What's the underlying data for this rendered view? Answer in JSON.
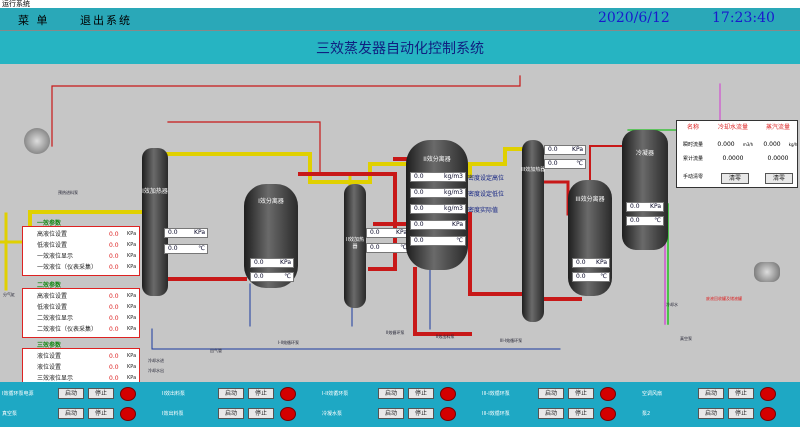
{
  "window": {
    "title": "运行系统"
  },
  "header": {
    "menu_label": "菜 单",
    "exit_label": "退出系统",
    "date": "2020/6/12",
    "time": "17:23:40"
  },
  "main": {
    "title": "三效蒸发器自动化控制系统"
  },
  "panels": {
    "one": {
      "title": "一效参数",
      "rows": [
        {
          "label": "高液位设置",
          "value": "0.0",
          "unit": "KPa"
        },
        {
          "label": "低液位设置",
          "value": "0.0",
          "unit": "KPa"
        },
        {
          "label": "一效液位显示",
          "value": "0.0",
          "unit": "KPa"
        },
        {
          "label": "一效液位（仪表采集）",
          "value": "0.0",
          "unit": "KPa"
        }
      ]
    },
    "two": {
      "title": "二效参数",
      "rows": [
        {
          "label": "高液位设置",
          "value": "0.0",
          "unit": "KPa"
        },
        {
          "label": "低液位设置",
          "value": "0.0",
          "unit": "KPa"
        },
        {
          "label": "二效液位显示",
          "value": "0.0",
          "unit": "KPa"
        },
        {
          "label": "二效液位（仪表采集）",
          "value": "0.0",
          "unit": "KPa"
        }
      ]
    },
    "three": {
      "title": "三效参数",
      "rows": [
        {
          "label": "液位设置",
          "value": "0.0",
          "unit": "KPa"
        },
        {
          "label": "液位设置",
          "value": "0.0",
          "unit": "KPa"
        },
        {
          "label": "三效液位显示",
          "value": "0.0",
          "unit": "KPa"
        },
        {
          "label": "三效液位（仪表采集）",
          "value": "0.0",
          "unit": "KPa"
        }
      ]
    }
  },
  "vessels": {
    "heater1": {
      "label": "I效加热器",
      "p": "0.0",
      "p_unit": "KPa",
      "t": "0.0",
      "t_unit": "℃"
    },
    "sep1": {
      "label": "I效分离器",
      "p": "0.0",
      "p_unit": "KPa",
      "t": "0.0",
      "t_unit": "℃"
    },
    "heater2": {
      "label": "II效加热器",
      "p": "0.0",
      "p_unit": "KPa",
      "t": "0.0",
      "t_unit": "℃"
    },
    "sep2": {
      "label": "II效分离器",
      "rows": [
        {
          "v": "0.0",
          "u": "kg/m3",
          "label": "密度设定高位"
        },
        {
          "v": "0.0",
          "u": "kg/m3",
          "label": "密度设定低位"
        },
        {
          "v": "0.0",
          "u": "kg/m3",
          "label": "密度实际值"
        },
        {
          "v": "0.0",
          "u": "KPa",
          "label": ""
        },
        {
          "v": "0.0",
          "u": "℃",
          "label": ""
        }
      ]
    },
    "heater3": {
      "label": "III效加热器",
      "p": "0.0",
      "p_unit": "KPa",
      "t": "0.0",
      "t_unit": "℃"
    },
    "sep3": {
      "label": "III效分离器",
      "p": "0.0",
      "p_unit": "KPa",
      "t": "0.0",
      "t_unit": "℃"
    },
    "condenser": {
      "label": "冷凝器",
      "p": "0.0",
      "p_unit": "KPa",
      "t": "0.0",
      "t_unit": "℃"
    }
  },
  "flow_table": {
    "name_hdr": "名称",
    "cool_hdr": "冷却水流量",
    "steam_hdr": "蒸汽流量",
    "rows": [
      {
        "label": "瞬时流量",
        "cool": "0.000",
        "cool_unit": "m3/h",
        "steam": "0.000",
        "steam_unit": "kg/h"
      },
      {
        "label": "累计流量",
        "cool": "0.0000",
        "steam": "0.0000"
      }
    ],
    "reset_label": "手动清零",
    "clear1": "清零",
    "clear2": "清零"
  },
  "labels": {
    "raw_tank": "原液储罐",
    "preheat_pump": "预热进料泵",
    "steam_in": "分气缸",
    "pump1": "I-II效循环泵",
    "pump2": "I-II效循环泵",
    "pump3": "II效循环泵",
    "pump4": "II效出料泵",
    "pump5": "III-I效循环泵",
    "cond_pump": "冷凝水泵",
    "vac_pump": "真空泵",
    "mother": "母液储罐",
    "cooling_in": "冷却水进",
    "cooling_out": "冷却水出",
    "cooling_water": "冷却水",
    "condensate": "冷凝水出口",
    "steam_line": "分汽缸",
    "outlet": "出料",
    "backwater": "回气管",
    "right_note": "废液回收罐及储液罐",
    "vacuum": "真空泵"
  },
  "bottom": {
    "groups": [
      {
        "label": "I效循环泵电源",
        "start": "启动",
        "stop": "停止"
      },
      {
        "label": "II效出料泵",
        "start": "启动",
        "stop": "停止"
      },
      {
        "label": "I-II效循环泵",
        "start": "启动",
        "stop": "停止"
      },
      {
        "label": "III-I效循环泵",
        "start": "启动",
        "stop": "停止"
      },
      {
        "label": "空调风扇",
        "start": "启动",
        "stop": "停止"
      },
      {
        "label": "真空泵",
        "start": "启动",
        "stop": "停止"
      },
      {
        "label": "I效出料泵",
        "start": "启动",
        "stop": "停止"
      },
      {
        "label": "冷凝水泵",
        "start": "启动",
        "stop": "停止"
      },
      {
        "label": "III-I效循环泵",
        "start": "启动",
        "stop": "停止"
      },
      {
        "label": "泵2",
        "start": "启动",
        "stop": "停止"
      }
    ]
  },
  "colors": {
    "teal": "#26b4c2",
    "red_pipe": "#c81818",
    "yellow_pipe": "#e0d000",
    "vessel": "#2a2a2a"
  }
}
